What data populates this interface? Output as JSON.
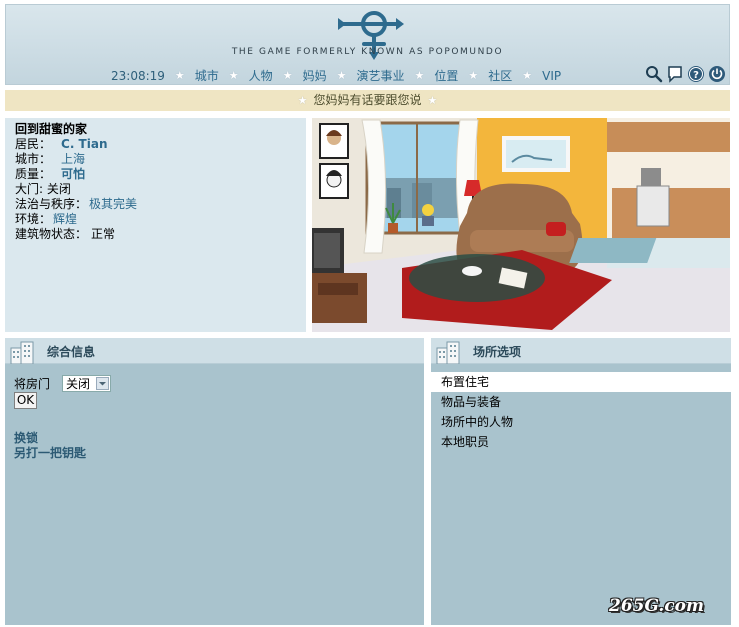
{
  "header": {
    "tagline": "THE GAME FORMERLY KNOWN AS POPOMUNDO",
    "time": "23:08:19",
    "nav": [
      "城市",
      "人物",
      "妈妈",
      "演艺事业",
      "位置",
      "社区",
      "VIP"
    ]
  },
  "message": "您妈妈有话要跟您说",
  "info": {
    "title": "回到甜蜜的家",
    "resident_label": "居民：",
    "resident": "C. Tian",
    "city_label": "城市：",
    "city": "上海",
    "quality_label": "质量：",
    "quality": "可怕",
    "door_label": "大门:",
    "door": "关闭",
    "security_label": "法治与秩序：",
    "security": "极其完美",
    "environment_label": "环境：",
    "environment": "辉煌",
    "building_label": "建筑物状态：",
    "building": "正常"
  },
  "general": {
    "title": "综合信息",
    "door_label": "将房门",
    "door_select": "关闭",
    "ok": "OK",
    "change_lock": "换锁",
    "new_key": "另打一把钥匙"
  },
  "options": {
    "title": "场所选项",
    "items": [
      "布置住宅",
      "物品与装备",
      "场所中的人物",
      "本地职员"
    ]
  },
  "watermark": "265G.com",
  "colors": {
    "header_bg": "#c9dbe3",
    "panel_bg": "#a9c3cd",
    "link": "#2e6b8e",
    "message_bg": "#efe5c3"
  }
}
